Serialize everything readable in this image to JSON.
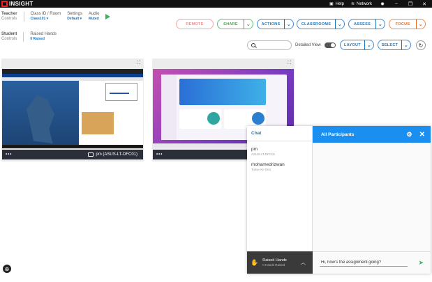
{
  "titlebar": {
    "app_name": "INSIGHT",
    "help_label": "Help",
    "network_label": "Network"
  },
  "toolbar": {
    "teacher_label": "Teacher",
    "teacher_sub": "Controls",
    "class_label": "Class ID / Room",
    "class_value": "Class101",
    "settings_label": "Settings",
    "settings_value": "Default",
    "audio_label": "Audio",
    "audio_value": "Muted",
    "student_label": "Student",
    "student_sub": "Controls",
    "raised_label": "Raised Hands",
    "raised_value": "0 Raised"
  },
  "buttons": {
    "remote": "REMOTE",
    "share": "SHARE",
    "actions": "ACTIONS",
    "classrooms": "CLASSROOMS",
    "assess": "ASSESS",
    "focus": "FOCUS",
    "layout": "LAYOUT",
    "select": "SELECT"
  },
  "view": {
    "detailed_view_label": "Detailed View",
    "search_placeholder": ""
  },
  "tiles": [
    {
      "name": "pm (ASUS-LT-DFC01)"
    },
    {
      "name": "mohamedrizwan"
    }
  ],
  "chat": {
    "tab_label": "Chat",
    "header": "All Participants",
    "participants": [
      {
        "name": "pm",
        "device": "ASUS-LT-DFC01"
      },
      {
        "name": "mohamedrizwan",
        "device": "Tomo-Air-Test"
      }
    ],
    "raised_hands_label": "Raised Hands",
    "raised_hands_count": "0 Hands Raised",
    "message_value": "Hi, how's the assignment going?"
  },
  "colors": {
    "primary_blue": "#1b75bb",
    "share_green": "#3caa4c",
    "focus_orange": "#e56b1f",
    "remote_red": "#f28c8c",
    "chat_header": "#1b8ff0"
  }
}
